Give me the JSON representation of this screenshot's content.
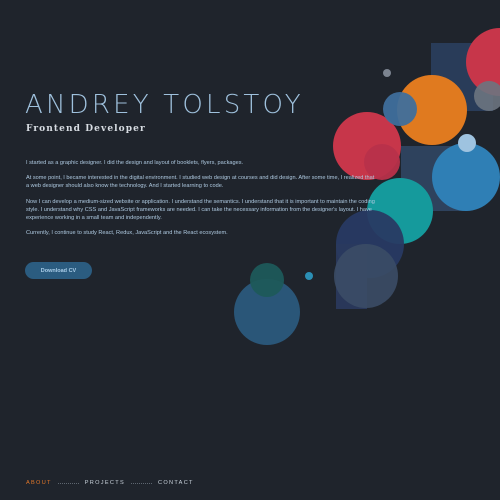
{
  "hero": {
    "name": "ANDREY TOLSTOY",
    "role": "Frontend Developer"
  },
  "about": {
    "paragraphs": [
      "I started as a graphic designer. I did the design and layout of booklets, flyers, packages.",
      "At some point, I became interested in the digital environment. I studied web design at courses and did design. After some time, I realized that a web designer should also know the technology. And I started learning to code.",
      "Now I can develop a medium-sized website or application. I understand the semantics. I understand that it is important to maintain the coding style. I understand why CSS and JavaScript frameworks are needed. I can take the necessary information from the designer's layout. I have experience working in a small team and independently.",
      "Currently, I continue to study React, Redux, JavaScript and the React ecosystem."
    ],
    "cv_button_label": "Download CV"
  },
  "nav": {
    "items": [
      {
        "label": "ABOUT",
        "active": true
      },
      {
        "label": "PROJECTS",
        "active": false
      },
      {
        "label": "CONTACT",
        "active": false
      }
    ]
  },
  "colors": {
    "background": "#1f242c",
    "accent": "#e2772a",
    "name_text": "#9fc1dd",
    "button_bg": "#2b5c80",
    "circle_red": "#c7364a",
    "circle_orange": "#e07a1f",
    "circle_blue": "#2f7fb5",
    "circle_teal": "#159a9c",
    "circle_navy": "#283a63",
    "circle_slate": "#3b4d66",
    "circle_gray": "#6b7480"
  }
}
